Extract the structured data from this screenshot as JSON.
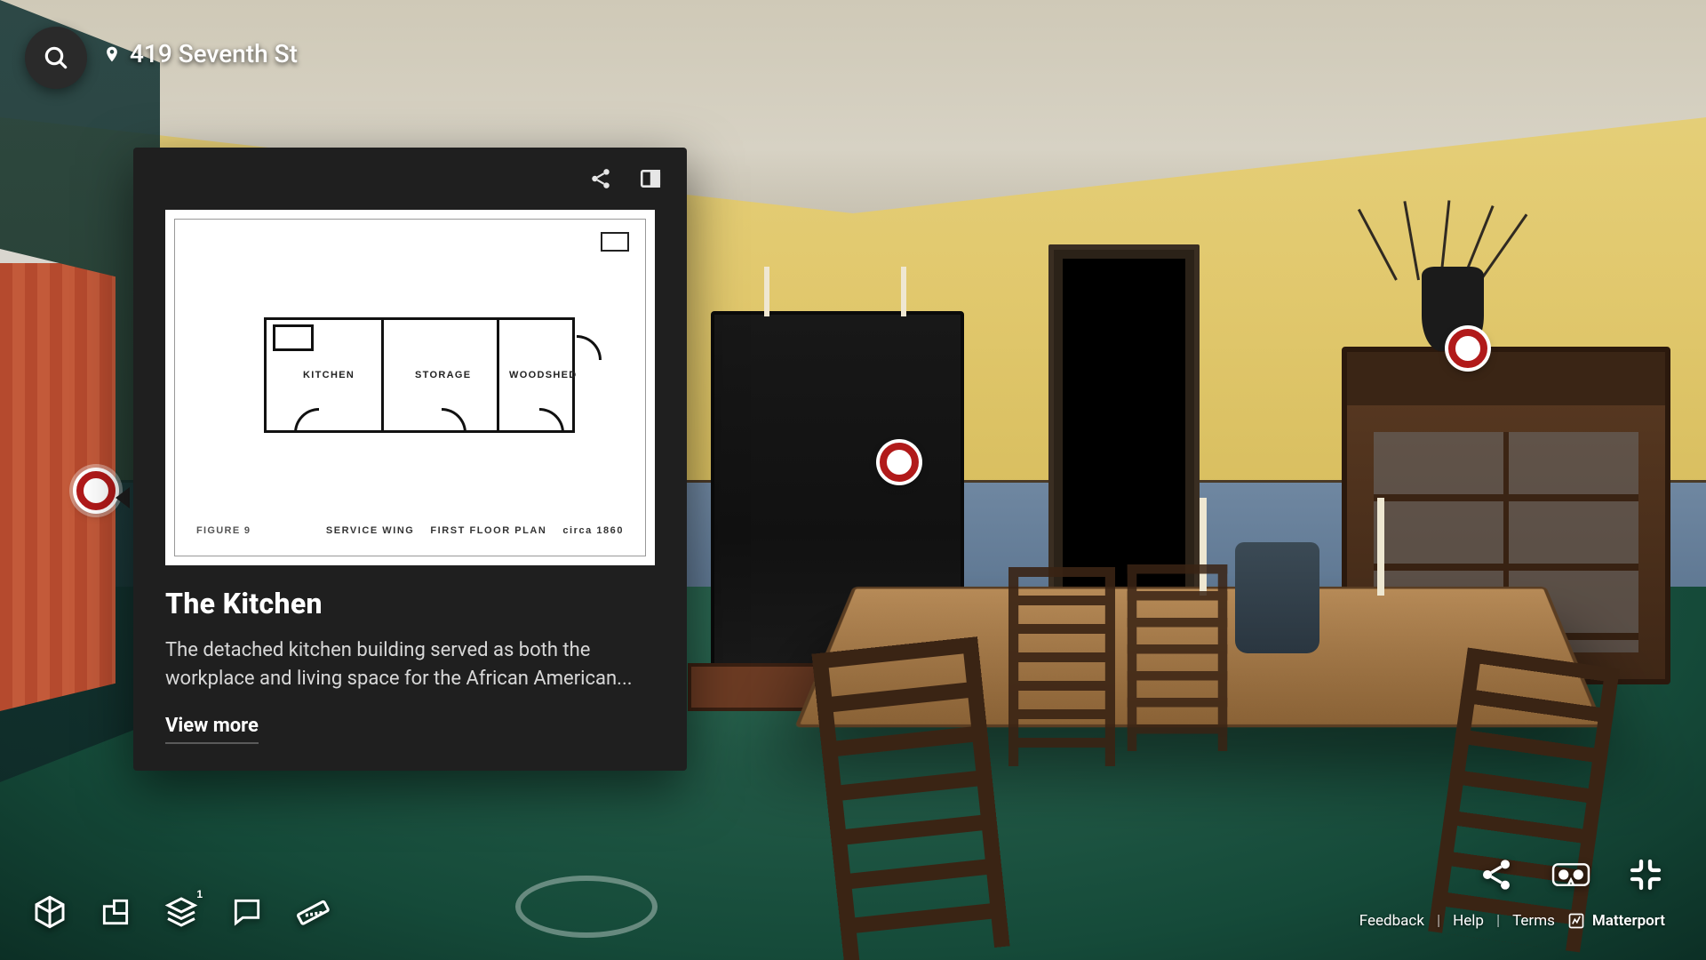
{
  "header": {
    "address": "419 Seventh St"
  },
  "panel": {
    "title": "The Kitchen",
    "description": "The detached kitchen building served as both the workplace and living space for the African American...",
    "view_more": "View more",
    "floorplan": {
      "room_kitchen": "KITCHEN",
      "room_storage": "STORAGE",
      "room_woodshed": "WOODSHED",
      "figure": "FIGURE 9",
      "caption_main": "SERVICE WING",
      "caption_sub": "FIRST FLOOR PLAN",
      "caption_circa": "circa 1860"
    }
  },
  "toolbar_left": {
    "layers_badge": "1"
  },
  "footer": {
    "feedback": "Feedback",
    "help": "Help",
    "terms": "Terms",
    "brand": "Matterport"
  }
}
